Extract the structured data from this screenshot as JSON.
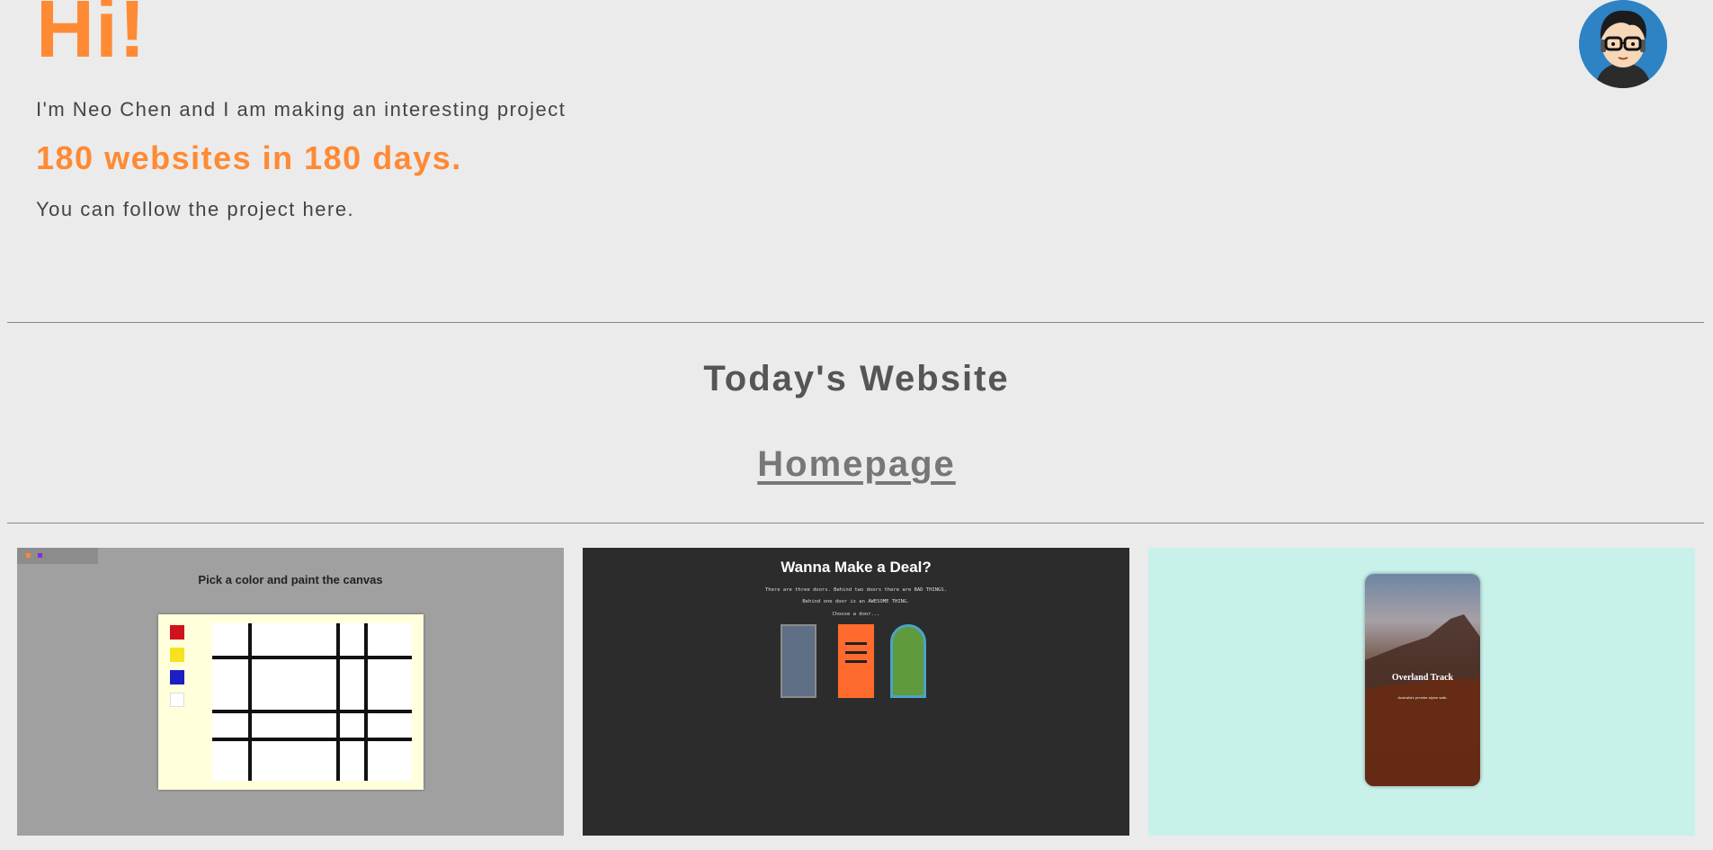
{
  "hero": {
    "title": "Hi!",
    "intro": "I'm Neo Chen and I am making an interesting project",
    "tagline": "180 websites in 180 days.",
    "follow": "You can follow the project here."
  },
  "avatar": {
    "icon": "avatar-icon"
  },
  "section": {
    "title": "Today's Website",
    "link_label": "Homepage"
  },
  "cards": {
    "paint": {
      "title": "Pick a color and paint the canvas",
      "swatches": [
        "#d0121b",
        "#f6e21f",
        "#1a1fc4",
        "#ffffff"
      ]
    },
    "deal": {
      "title": "Wanna Make a Deal?",
      "lines": [
        "There are three doors. Behind two doors there are BAD THINGS.",
        "Behind one door is an AWESOME THING.",
        "Choose a door..."
      ]
    },
    "hike": {
      "title": "Overland Track",
      "subtitle": "Australia's premier alpine walk."
    }
  },
  "colors": {
    "accent": "#ff8a34",
    "background": "#ebebeb",
    "text": "#444444"
  }
}
